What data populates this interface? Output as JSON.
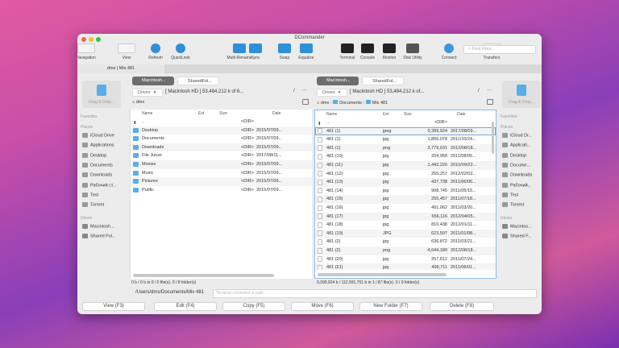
{
  "window": {
    "title": "DCommander",
    "tab": "dmx | Mix 481"
  },
  "toolbar": [
    {
      "label": "Navigation",
      "icon": "back-forward-icon"
    },
    {
      "label": "View",
      "icon": "view-mode-icon"
    },
    {
      "label": "Refresh",
      "icon": "refresh-icon"
    },
    {
      "label": "QuickLook",
      "icon": "quicklook-icon"
    },
    {
      "label": "Multi-Rename",
      "icon": "multi-rename-icon"
    },
    {
      "label": "Sync",
      "icon": "sync-icon"
    },
    {
      "label": "Swap",
      "icon": "swap-icon"
    },
    {
      "label": "Equalize",
      "icon": "equalize-icon"
    },
    {
      "label": "Terminal",
      "icon": "terminal-icon"
    },
    {
      "label": "Console",
      "icon": "console-icon"
    },
    {
      "label": "Monitor",
      "icon": "monitor-icon"
    },
    {
      "label": "Disk Utility",
      "icon": "disk-utility-icon"
    },
    {
      "label": "Connect",
      "icon": "globe-icon"
    },
    {
      "label": "Transfers",
      "icon": "transfers-icon"
    }
  ],
  "search": {
    "placeholder": "Find Files..."
  },
  "colors": {
    "accent": "#2f8fd8",
    "folder": "#5aaee8",
    "selection": "#6aa8e0"
  },
  "left_sidebar": {
    "drag": "Drag & Drop...",
    "favorites": "Favorites",
    "places": "Places",
    "items": [
      "iCloud Drive",
      "Applications",
      "Desktop",
      "Documents",
      "Downloads",
      "Рабочий ст...",
      "Test",
      "Torrent"
    ],
    "drives_title": "Drives",
    "drives": [
      "Macintosh...",
      "Shared Fol..."
    ]
  },
  "right_sidebar": {
    "drag": "Drag & Drop...",
    "favorites": "Favorites",
    "places": "Places",
    "items": [
      "iCloud Dr...",
      "Applicati...",
      "Desktop",
      "Docume...",
      "Downloads",
      "Рабочий...",
      "Test",
      "Torrent"
    ],
    "drives_title": "Drives",
    "drives": [
      "Macintos...",
      "Shared F..."
    ]
  },
  "left_panel": {
    "drive_tabs": [
      "Macintosh...",
      "SharedFol..."
    ],
    "drives_label": "Drives",
    "volume": "[ Macintosh HD ]  53,484,212 k of 6...",
    "path": [
      "dmx"
    ],
    "columns": [
      "Name",
      "Ext",
      "Size",
      "Date"
    ],
    "rows": [
      {
        "name": "..",
        "size": "<DIR>",
        "date": ""
      },
      {
        "name": "Desktop",
        "size": "<DIR>",
        "date": "2015/07/09..."
      },
      {
        "name": "Documents",
        "size": "<DIR>",
        "date": "2015/07/09..."
      },
      {
        "name": "Downloads",
        "size": "<DIR>",
        "date": "2015/07/09..."
      },
      {
        "name": "File Juicer",
        "size": "<DIR>",
        "date": "2017/08/11..."
      },
      {
        "name": "Movies",
        "size": "<DIR>",
        "date": "2015/07/09..."
      },
      {
        "name": "Music",
        "size": "<DIR>",
        "date": "2015/07/09..."
      },
      {
        "name": "Pictures",
        "size": "<DIR>",
        "date": "2015/07/09..."
      },
      {
        "name": "Public",
        "size": "<DIR>",
        "date": "2015/07/09..."
      }
    ],
    "status": "0 b / 0 b in 0 / 0 file(s).  0 / 8 folder(s)"
  },
  "right_panel": {
    "drive_tabs": [
      "Macintosh...",
      "SharedFol..."
    ],
    "drives_label": "Drives",
    "volume": "[ Macintosh HD ]  53,484,212 k of...",
    "path": [
      "dmx",
      "Documents",
      "Mix 481"
    ],
    "columns": [
      "Name",
      "Ext",
      "Size",
      "Date"
    ],
    "rows": [
      {
        "name": "..",
        "ext": "",
        "size": "<DIR>",
        "date": ""
      },
      {
        "name": "481 (1)",
        "ext": "jpeg",
        "size": "9,399,924",
        "date": "2017/08/09..."
      },
      {
        "name": "481 (1)",
        "ext": "jpg",
        "size": "1,856,078",
        "date": "2011/10/24..."
      },
      {
        "name": "481 (1)",
        "ext": "png",
        "size": "3,779,631",
        "date": "2012/08/18..."
      },
      {
        "name": "481 (10)",
        "ext": "jpg",
        "size": "254,958",
        "date": "2011/08/06..."
      },
      {
        "name": "481 (11)",
        "ext": "jpg",
        "size": "1,442,226",
        "date": "2010/09/22..."
      },
      {
        "name": "481 (12)",
        "ext": "jpg",
        "size": "255,257",
        "date": "2012/02/02..."
      },
      {
        "name": "481 (13)",
        "ext": "jpg",
        "size": "437,738",
        "date": "2011/06/06..."
      },
      {
        "name": "481 (14)",
        "ext": "jpg",
        "size": "908,745",
        "date": "2011/05/15..."
      },
      {
        "name": "481 (15)",
        "ext": "jpg",
        "size": "255,457",
        "date": "2011/07/18..."
      },
      {
        "name": "481 (16)",
        "ext": "jpg",
        "size": "491,062",
        "date": "2011/03/20..."
      },
      {
        "name": "481 (17)",
        "ext": "jpg",
        "size": "656,116",
        "date": "2012/04/05..."
      },
      {
        "name": "481 (18)",
        "ext": "jpg",
        "size": "810,438",
        "date": "2012/01/11..."
      },
      {
        "name": "481 (19)",
        "ext": "JPG",
        "size": "623,597",
        "date": "2011/01/08..."
      },
      {
        "name": "481 (2)",
        "ext": "jpg",
        "size": "636,872",
        "date": "2011/03/21..."
      },
      {
        "name": "481 (2)",
        "ext": "png",
        "size": "4,644,180",
        "date": "2012/08/18..."
      },
      {
        "name": "481 (20)",
        "ext": "jpg",
        "size": "257,612",
        "date": "2011/07/24..."
      },
      {
        "name": "481 (21)",
        "ext": "jpg",
        "size": "499,711",
        "date": "2011/06/01..."
      }
    ],
    "status": "9,399,924 b / 112,591,751 b in 1 / 87 file(s).  0 / 0 folder(s)"
  },
  "command": {
    "path": "/Users/dmx/Documents/Mix 481",
    "placeholder": "Terminal command at path"
  },
  "buttons": [
    "View (F3)",
    "Edit (F4)",
    "Copy (F5)",
    "Move (F6)",
    "New Folder (F7)",
    "Delete (F8)"
  ]
}
